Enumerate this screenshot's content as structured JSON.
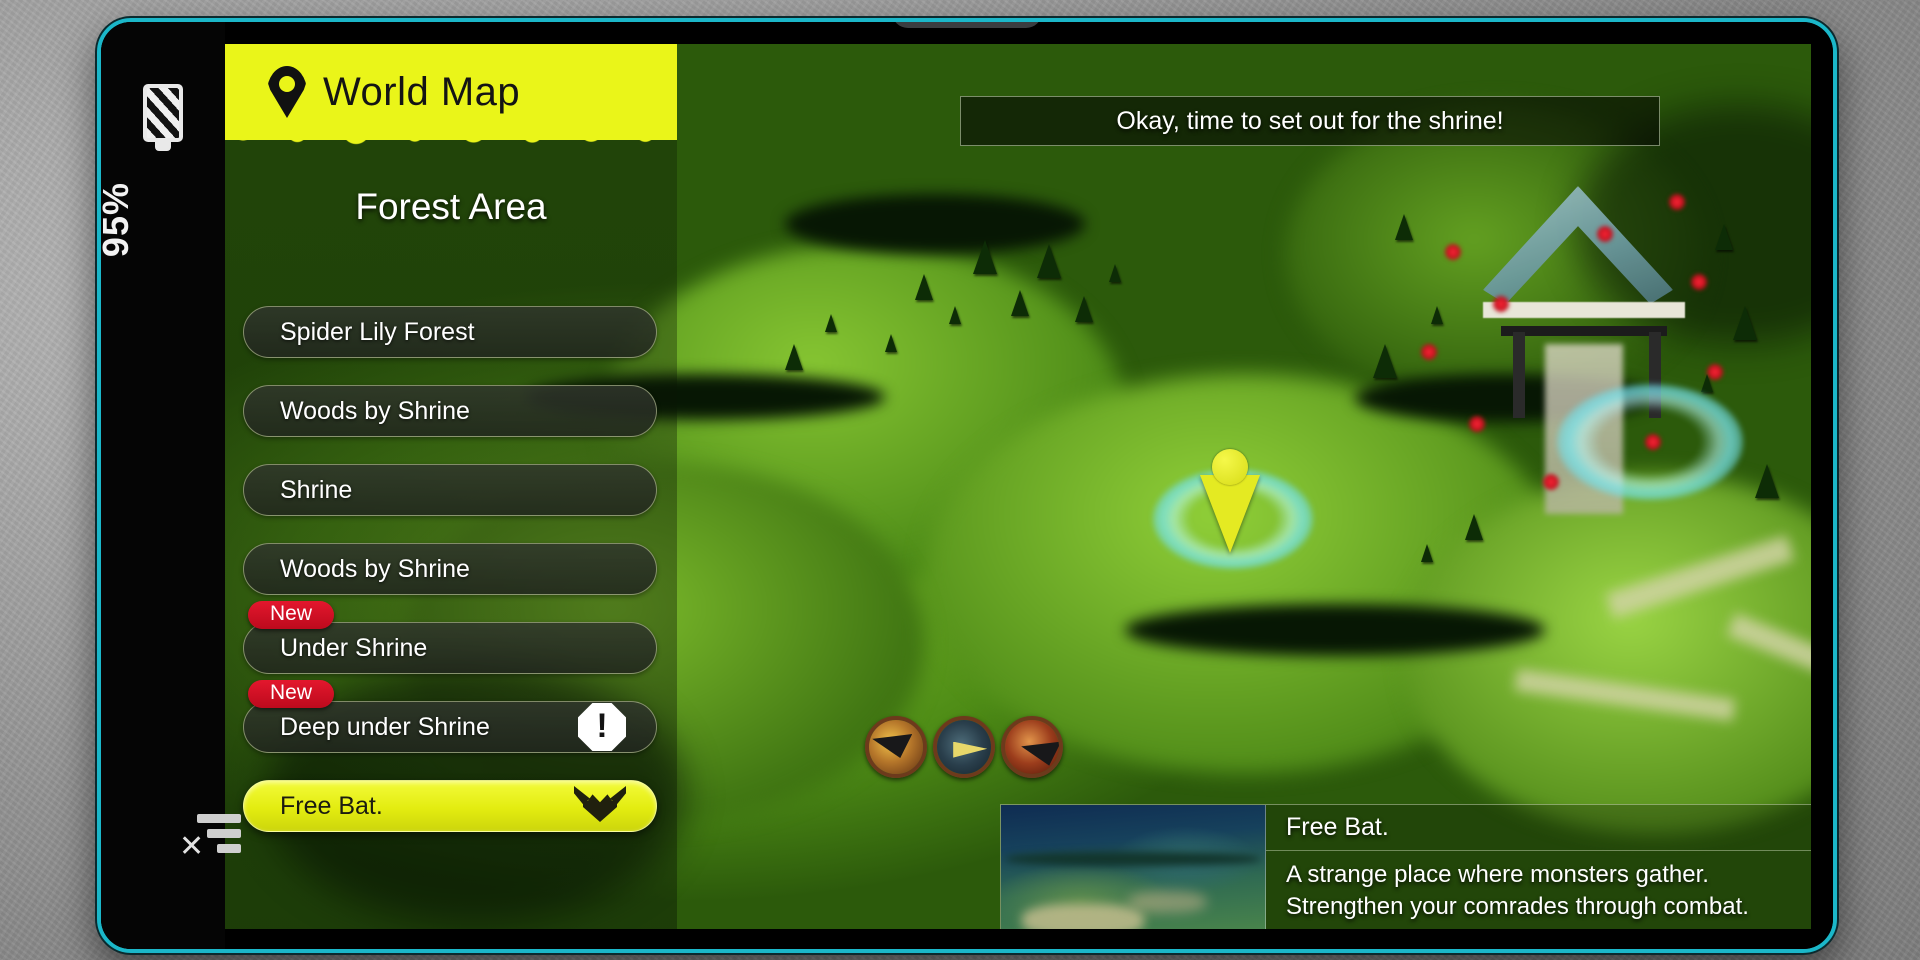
{
  "device": {
    "bezel_color": "#1bb7c9",
    "status": {
      "battery_icon": "battery-charging-icon",
      "battery_percent": "95%",
      "network_icon": "signal-off-icon"
    }
  },
  "sidebar": {
    "banner": {
      "icon": "map-pin-icon",
      "title": "World Map",
      "accent_color": "#eaf519"
    },
    "area_title": "Forest Area",
    "locations": [
      {
        "label": "Spider Lily Forest",
        "badge": null,
        "icon": null,
        "selected": false
      },
      {
        "label": "Woods by Shrine",
        "badge": null,
        "icon": null,
        "selected": false
      },
      {
        "label": "Shrine",
        "badge": null,
        "icon": null,
        "selected": false
      },
      {
        "label": "Woods by Shrine",
        "badge": null,
        "icon": null,
        "selected": false
      },
      {
        "label": "Under Shrine",
        "badge": "New",
        "icon": null,
        "selected": false
      },
      {
        "label": "Deep under Shrine",
        "badge": "New",
        "icon": "alert-exclamation-icon",
        "selected": false
      },
      {
        "label": "Free Bat.",
        "badge": null,
        "icon": "bat-monster-icon",
        "selected": true
      }
    ],
    "badge_color": "#d1101f",
    "selected_color": "#e3ec10"
  },
  "dialogue": {
    "text": "Okay, time to set out for the shrine!"
  },
  "party": [
    {
      "name": "party-member-1"
    },
    {
      "name": "party-member-2"
    },
    {
      "name": "party-member-3"
    }
  ],
  "info_panel": {
    "thumbnail_alt": "location-preview",
    "title": "Free Bat.",
    "description_line1": "A strange place where monsters gather.",
    "description_line2": "Strengthen your comrades through combat."
  },
  "map": {
    "player_marker": "player-position-marker",
    "landmarks": [
      {
        "name": "shrine-torii-gate"
      },
      {
        "name": "glow-ring-player"
      },
      {
        "name": "glow-ring-secondary"
      }
    ]
  }
}
